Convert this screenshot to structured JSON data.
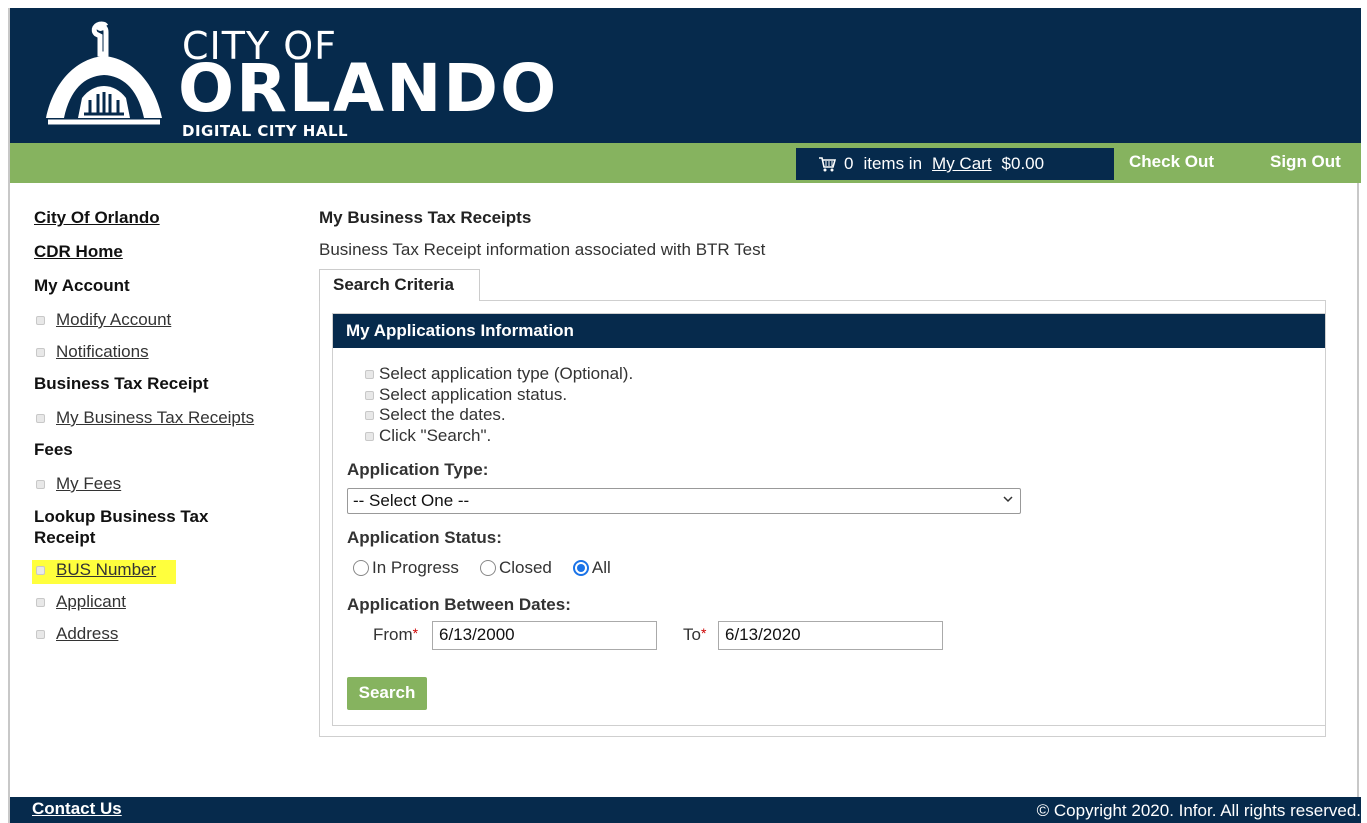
{
  "header": {
    "logo_line1": "CITY OF",
    "logo_line2": "ORLANDO",
    "logo_line3": "DIGITAL CITY HALL"
  },
  "cart": {
    "icon": "shopping-cart-icon",
    "count": "0",
    "items_in": "items in",
    "link": "My Cart",
    "total": "$0.00"
  },
  "topnav": {
    "checkout": "Check Out",
    "signout": "Sign Out"
  },
  "sidebar": {
    "city_of_orlando": "City Of Orlando",
    "cdr_home": "CDR Home",
    "my_account": "My Account",
    "modify_account": "Modify Account",
    "notifications": "Notifications",
    "btr_head": "Business Tax Receipt",
    "my_btr": "My Business Tax Receipts",
    "fees_head": "Fees",
    "my_fees": "My Fees",
    "lookup_head": "Lookup Business Tax Receipt",
    "bus_number": "BUS Number",
    "applicant": "Applicant",
    "address": "Address",
    "highlight_color": "#ffff3d"
  },
  "main": {
    "title": "My Business Tax Receipts",
    "description": "Business Tax Receipt information associated with  BTR Test",
    "tab": "Search Criteria",
    "panel_title": "My Applications Information",
    "steps": [
      "Select application type (Optional).",
      "Select application status.",
      "Select the dates.",
      "Click \"Search\"."
    ],
    "app_type_label": "Application Type:",
    "app_type_value": "-- Select One --",
    "app_status_label": "Application Status:",
    "status_options": [
      "In Progress",
      "Closed",
      "All"
    ],
    "status_selected": "All",
    "dates_label": "Application Between Dates:",
    "from_label": "From",
    "from_value": "6/13/2000",
    "to_label": "To",
    "to_value": "6/13/2020",
    "required_mark": "*",
    "search_button": "Search"
  },
  "footer": {
    "contact": "Contact Us",
    "copyright": "© Copyright 2020. Infor. All rights reserved."
  },
  "colors": {
    "navy": "#062a4c",
    "green": "#86b35f"
  }
}
